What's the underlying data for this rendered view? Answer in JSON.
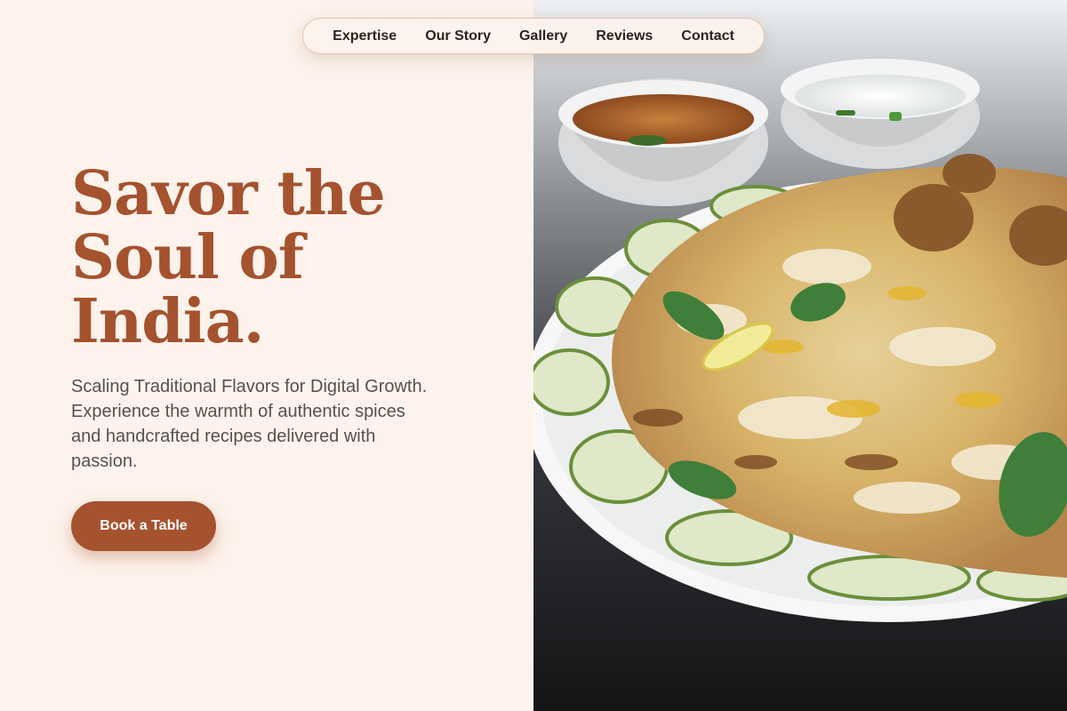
{
  "nav": {
    "items": [
      {
        "label": "Expertise"
      },
      {
        "label": "Our Story"
      },
      {
        "label": "Gallery"
      },
      {
        "label": "Reviews"
      },
      {
        "label": "Contact"
      }
    ]
  },
  "hero": {
    "headline_lines": [
      "Savor the",
      "Soul of",
      "India."
    ],
    "subtext_lines": [
      "Scaling Traditional Flavors for Digital Growth.",
      "Experience the warmth of authentic spices",
      "and handcrafted recipes delivered with",
      "passion."
    ],
    "cta_label": "Book a Table"
  },
  "image": {
    "subject": "biryani-plate-photo"
  },
  "colors": {
    "background": "#fdf3ec",
    "accent": "#a5522f",
    "text": "#2a2320",
    "muted_text": "#57504c"
  }
}
